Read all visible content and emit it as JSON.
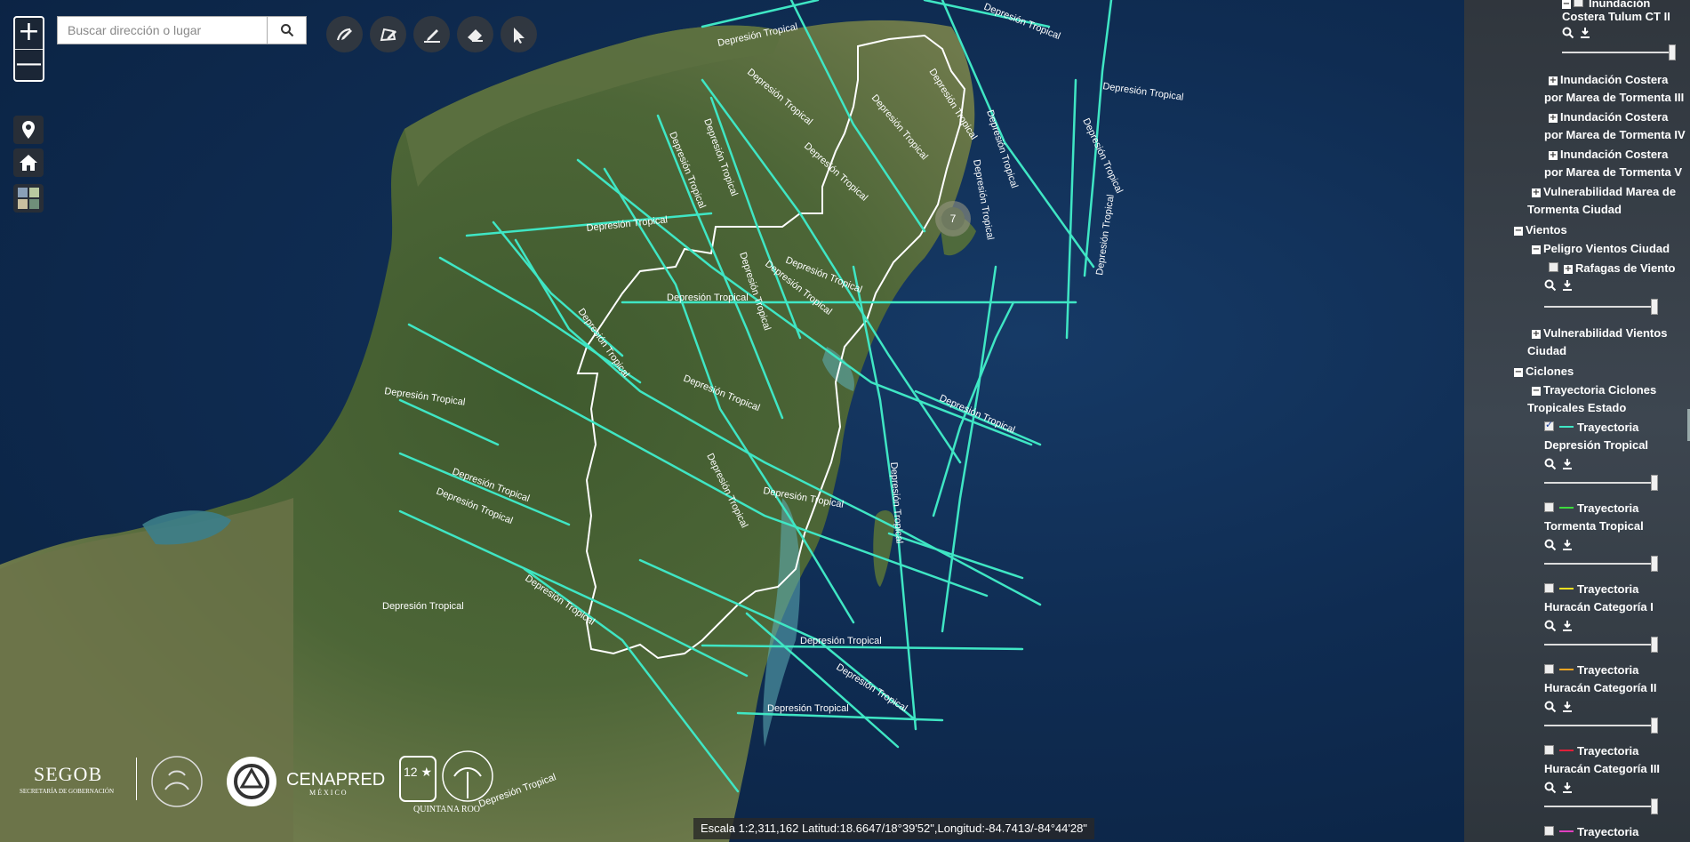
{
  "search": {
    "placeholder": "Buscar dirección o lugar"
  },
  "zoom": {
    "in_label": "+",
    "out_label": "—"
  },
  "cluster": {
    "count": "7"
  },
  "scale_text": "Escala 1:2,311,162 Latitud:18.6647/18°39'52\",Longitud:-84.7413/-84°44'28\"",
  "track_label": "Depresión Tropical",
  "track_color": "#3fe6c4",
  "logos": {
    "segob": "SEGOB",
    "segob_sub": "SECRETARÍA DE GOBERNACIÓN",
    "cenapred": "CENAPRED",
    "cenapred_sub": "MÉXICO",
    "qroo_sub": "QUINTANA ROO"
  },
  "panel": {
    "top_partial": "Inundación",
    "costera_tulum_ct2": "Costera Tulum CT II",
    "inund_iii": [
      "Inundación Costera",
      "por Marea de Tormenta III"
    ],
    "inund_iv": [
      "Inundación Costera",
      "por Marea de Tormenta IV"
    ],
    "inund_v": [
      "Inundación Costera",
      "por Marea de Tormenta V"
    ],
    "vuln_marea": [
      "Vulnerabilidad Marea de",
      "Tormenta Ciudad"
    ],
    "vientos": "Vientos",
    "peligro_vientos": "Peligro Vientos Ciudad",
    "rafagas": "Rafagas de Viento",
    "vuln_vientos": [
      "Vulnerabilidad Vientos",
      "Ciudad"
    ],
    "ciclones": "Ciclones",
    "trayectoria_estado": [
      "Trayectoria Ciclones",
      "Tropicales Estado"
    ],
    "layers": [
      {
        "line1": "Trayectoria",
        "line2": "Depresión Tropical",
        "checked": true,
        "color": "#3fe6c4"
      },
      {
        "line1": "Trayectoria",
        "line2": "Tormenta Tropical",
        "checked": false,
        "color": "#3ddc3d"
      },
      {
        "line1": "Trayectoria",
        "line2": "Huracán Categoría I",
        "checked": false,
        "color": "#f0e020"
      },
      {
        "line1": "Trayectoria",
        "line2": "Huracán Categoría II",
        "checked": false,
        "color": "#f5a623"
      },
      {
        "line1": "Trayectoria",
        "line2": "Huracán Categoría III",
        "checked": false,
        "color": "#e0203a"
      },
      {
        "line1": "Trayectoria",
        "line2": "",
        "checked": false,
        "color": "#e040c0"
      }
    ]
  }
}
